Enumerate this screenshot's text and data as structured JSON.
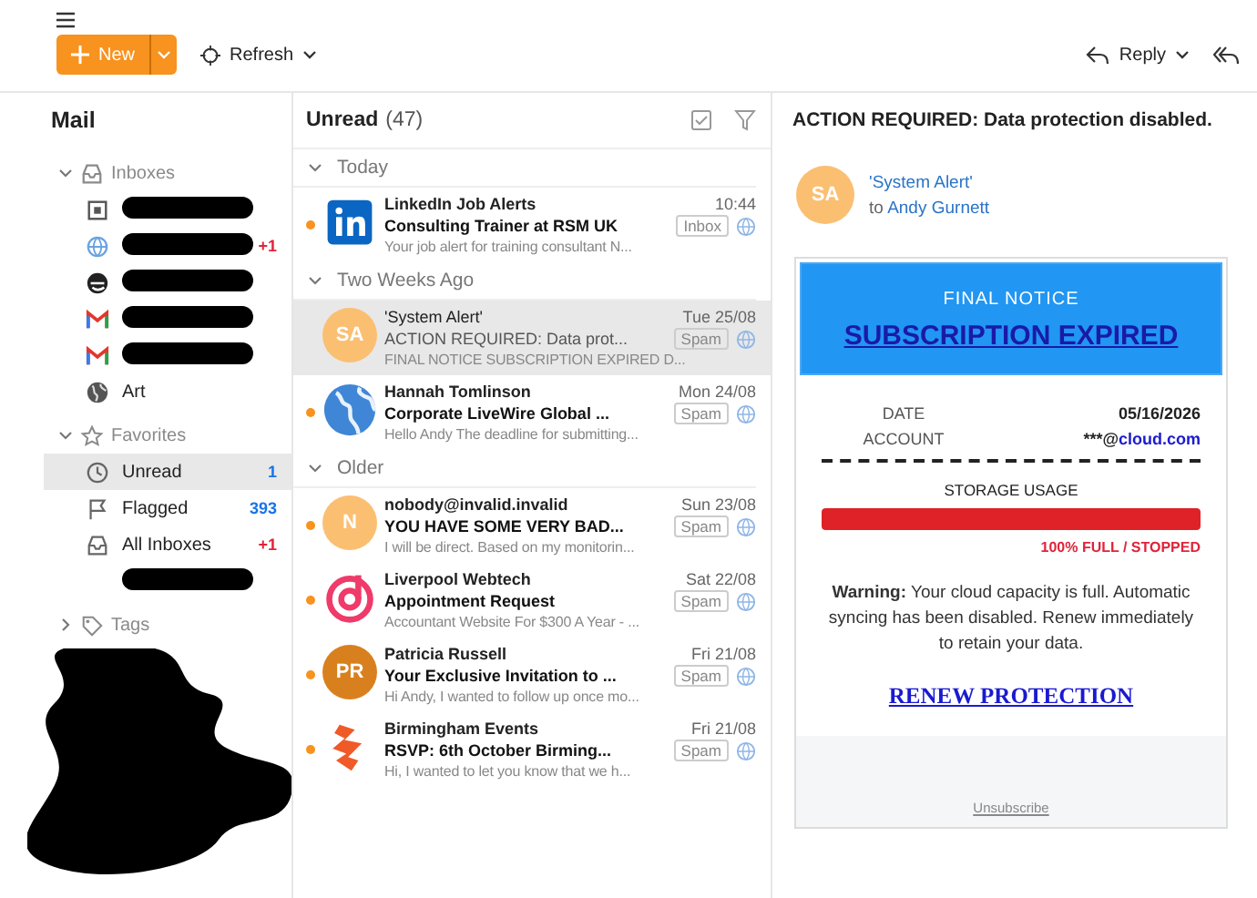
{
  "toolbar": {
    "new_label": "New",
    "refresh_label": "Refresh",
    "reply_label": "Reply"
  },
  "sidebar": {
    "title": "Mail",
    "groups": [
      {
        "label": "Inboxes",
        "expanded": true,
        "items": [
          {
            "kind": "redacted",
            "selected": false
          },
          {
            "kind": "redacted",
            "count": "+1",
            "color": "#e0243a",
            "selected": false
          },
          {
            "kind": "redacted",
            "selected": false
          },
          {
            "kind": "redacted",
            "selected": false
          },
          {
            "kind": "redacted",
            "selected": false
          },
          {
            "kind": "folder",
            "label": "Art",
            "selected": false
          }
        ]
      },
      {
        "label": "Favorites",
        "expanded": true,
        "items": [
          {
            "kind": "folder",
            "label": "Unread",
            "count": "1",
            "color": "#1a73e8",
            "selected": true
          },
          {
            "kind": "folder",
            "label": "Flagged",
            "count": "393",
            "color": "#1a73e8",
            "selected": false
          },
          {
            "kind": "folder",
            "label": "All Inboxes",
            "count": "+1",
            "color": "#e0243a",
            "selected": false
          },
          {
            "kind": "redacted",
            "selected": false
          }
        ]
      },
      {
        "label": "Tags",
        "expanded": false
      }
    ]
  },
  "message_list": {
    "title": "Unread",
    "count": "(47)",
    "groups": [
      {
        "label": "Today",
        "messages": [
          {
            "avatar": {
              "kind": "linkedin"
            },
            "sender": "LinkedIn Job Alerts",
            "date": "10:44",
            "subject": "Consulting Trainer at RSM UK",
            "tag": "Inbox",
            "preview": "Your job alert for training consultant N...",
            "unread": true,
            "selected": false
          }
        ]
      },
      {
        "label": "Two Weeks Ago",
        "messages": [
          {
            "avatar": {
              "kind": "initials",
              "text": "SA",
              "color": "#fbbf72"
            },
            "sender": "'System Alert'",
            "date": "Tue 25/08",
            "subject": "ACTION REQUIRED: Data prot...",
            "tag": "Spam",
            "preview": "FINAL NOTICE SUBSCRIPTION EXPIRED D...",
            "unread": false,
            "selected": true
          },
          {
            "avatar": {
              "kind": "globe"
            },
            "sender": "Hannah Tomlinson",
            "date": "Mon 24/08",
            "subject": "Corporate LiveWire Global ...",
            "tag": "Spam",
            "preview": "Hello Andy The deadline for submitting...",
            "unread": true,
            "selected": false
          }
        ]
      },
      {
        "label": "Older",
        "messages": [
          {
            "avatar": {
              "kind": "initials",
              "text": "N",
              "color": "#fbbf72"
            },
            "sender": "nobody@invalid.invalid",
            "date": "Sun 23/08",
            "subject": "YOU HAVE SOME VERY BAD...",
            "tag": "Spam",
            "preview": "I will be direct. Based on my monitorin...",
            "unread": true,
            "selected": false
          },
          {
            "avatar": {
              "kind": "swirl"
            },
            "sender": "Liverpool Webtech",
            "date": "Sat 22/08",
            "subject": "Appointment Request",
            "tag": "Spam",
            "preview": "Accountant Website For $300 A Year - ...",
            "unread": true,
            "selected": false
          },
          {
            "avatar": {
              "kind": "initials",
              "text": "PR",
              "color": "#d9801e"
            },
            "sender": "Patricia Russell",
            "date": "Fri 21/08",
            "subject": "Your Exclusive Invitation to ...",
            "tag": "Spam",
            "preview": "Hi Andy, I wanted to follow up once mo...",
            "unread": true,
            "selected": false
          },
          {
            "avatar": {
              "kind": "flame"
            },
            "sender": "Birmingham Events",
            "date": "Fri 21/08",
            "subject": "RSVP: 6th October Birming...",
            "tag": "Spam",
            "preview": "Hi, I wanted to let you know that we h...",
            "unread": true,
            "selected": false
          }
        ]
      }
    ]
  },
  "reading_pane": {
    "subject": "ACTION REQUIRED: Data protection disabled.",
    "sender_initials": "SA",
    "sender": "'System Alert'",
    "to_label": "to",
    "recipient": "Andy Gurnett",
    "email": {
      "notice": "FINAL NOTICE",
      "headline": "SUBSCRIPTION EXPIRED",
      "fields": [
        {
          "label": "DATE",
          "value": "05/16/2026"
        },
        {
          "label": "ACCOUNT",
          "value": "***@",
          "link": "cloud.com"
        }
      ],
      "usage_label": "STORAGE USAGE",
      "usage": {
        "level": 1
      },
      "usage_status": "100% FULL / STOPPED",
      "warning": "**Warning:** Your cloud capacity is full. Automatic syncing has been disabled. Renew immediately to retain your data.",
      "cta": "RENEW PROTECTION",
      "footer_link": "Unsubscribe"
    }
  }
}
